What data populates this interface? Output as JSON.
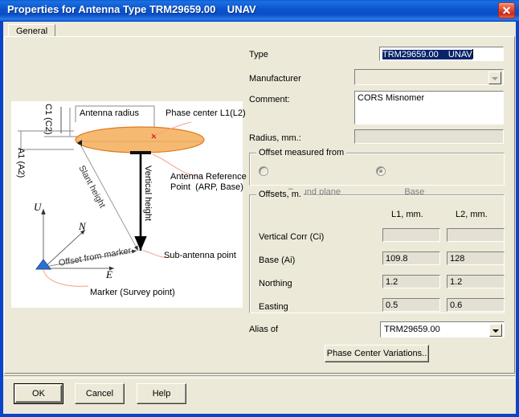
{
  "window": {
    "title": "Properties for Antenna Type TRM29659.00    UNAV",
    "close_label": "✕"
  },
  "tabs": [
    {
      "label": "General",
      "selected": true
    }
  ],
  "form": {
    "type": {
      "label": "Type",
      "value": "TRM29659.00    UNAV"
    },
    "manufacturer": {
      "label": "Manufacturer",
      "value": ""
    },
    "comment": {
      "label": "Comment:",
      "value": "CORS Misnomer"
    },
    "radius": {
      "label": "Radius, mm.:",
      "value": ""
    },
    "alias": {
      "label": "Alias of",
      "value": "TRM29659.00"
    },
    "phase_center_button": "Phase Center Variations.."
  },
  "offset_measured_from": {
    "title": "Offset measured from",
    "options": [
      {
        "label": "Ground plane",
        "selected": false
      },
      {
        "label": "Base",
        "selected": true
      }
    ]
  },
  "offsets": {
    "title": "Offsets, m.",
    "columns": [
      "L1, mm.",
      "L2, mm."
    ],
    "rows": [
      {
        "label": "Vertical Corr (Ci)",
        "l1": "",
        "l2": ""
      },
      {
        "label": "Base (Ai)",
        "l1": "109.8",
        "l2": "128"
      },
      {
        "label": "Northing",
        "l1": "1.2",
        "l2": "1.2"
      },
      {
        "label": "Easting",
        "l1": "0.5",
        "l2": "0.6"
      }
    ]
  },
  "buttons": {
    "ok": "OK",
    "cancel": "Cancel",
    "help": "Help"
  },
  "diagram": {
    "labels": {
      "c1": "C1 (C2)",
      "a1": "A1 (A2)",
      "antenna_radius": "Antenna radius",
      "phase_center": "Phase center L1(L2)",
      "slant_height": "Slant height",
      "vertical_height": "Vertical height",
      "arp_line1": "Antenna Reference",
      "arp_line2": "Point  (ARP, Base)",
      "sub_antenna": "Sub-antenna point",
      "marker": "Marker (Survey point)",
      "axis_up": "U",
      "axis_north": "N",
      "axis_east": "E",
      "offset_from_marker": "Offset from marker"
    },
    "colors": {
      "antenna_fill": "#f5b971",
      "antenna_stroke": "#e07b1e",
      "leader": "#f9a08a",
      "marker": "#2f6fd0",
      "phase_center_mark": "#e02020"
    }
  }
}
